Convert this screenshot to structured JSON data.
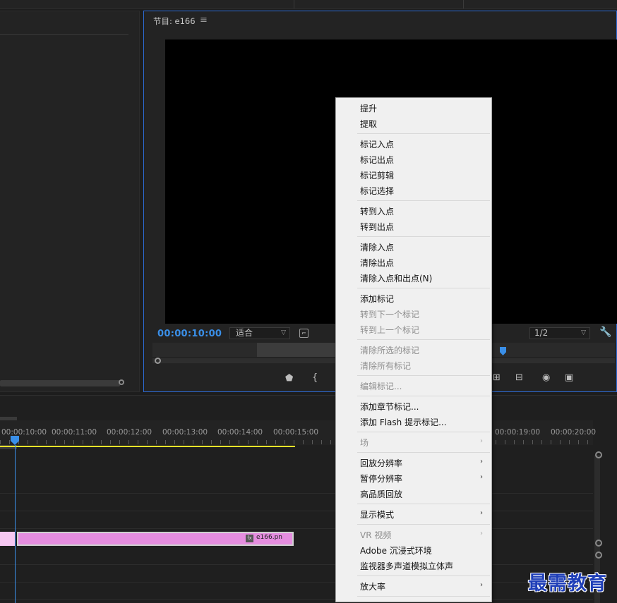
{
  "program_monitor": {
    "title": "节目: e166",
    "menu_icon": "≡",
    "timecode": "00:00:10:00",
    "fit_select": "适合",
    "resolution_select": "1/2"
  },
  "timeline": {
    "ruler_labels": [
      "00:00:10:00",
      "00:00:11:00",
      "00:00:12:00",
      "00:00:13:00",
      "00:00:14:00",
      "00:00:15:00",
      "00:00:19:00",
      "00:00:20:00"
    ],
    "clip_name": "e166.pn",
    "clip_fx": "fx"
  },
  "context_menu": {
    "items": [
      {
        "label": "提升",
        "enabled": true
      },
      {
        "label": "提取",
        "enabled": true
      },
      {
        "label": "标记入点",
        "enabled": true
      },
      {
        "label": "标记出点",
        "enabled": true
      },
      {
        "label": "标记剪辑",
        "enabled": true
      },
      {
        "label": "标记选择",
        "enabled": true
      },
      {
        "label": "转到入点",
        "enabled": true
      },
      {
        "label": "转到出点",
        "enabled": true
      },
      {
        "label": "清除入点",
        "enabled": true
      },
      {
        "label": "清除出点",
        "enabled": true
      },
      {
        "label": "清除入点和出点(N)",
        "enabled": true
      },
      {
        "label": "添加标记",
        "enabled": true
      },
      {
        "label": "转到下一个标记",
        "enabled": false
      },
      {
        "label": "转到上一个标记",
        "enabled": false
      },
      {
        "label": "清除所选的标记",
        "enabled": false
      },
      {
        "label": "清除所有标记",
        "enabled": false
      },
      {
        "label": "编辑标记...",
        "enabled": false
      },
      {
        "label": "添加章节标记...",
        "enabled": true
      },
      {
        "label": "添加 Flash 提示标记...",
        "enabled": true
      },
      {
        "label": "场",
        "enabled": false,
        "submenu": true
      },
      {
        "label": "回放分辨率",
        "enabled": true,
        "submenu": true
      },
      {
        "label": "暂停分辨率",
        "enabled": true,
        "submenu": true
      },
      {
        "label": "高品质回放",
        "enabled": true
      },
      {
        "label": "显示模式",
        "enabled": true,
        "submenu": true
      },
      {
        "label": "VR 视频",
        "enabled": false,
        "submenu": true
      },
      {
        "label": "Adobe 沉浸式环境",
        "enabled": true
      },
      {
        "label": "监视器多声道模拟立体声",
        "enabled": true
      },
      {
        "label": "放大率",
        "enabled": true,
        "submenu": true
      }
    ]
  },
  "watermark": "最需教育",
  "colors": {
    "accent_blue": "#3a8fe8",
    "work_area_yellow": "#f2e32a",
    "clip_pink": "#e58ddf",
    "menu_bg": "#f0f0f0"
  }
}
